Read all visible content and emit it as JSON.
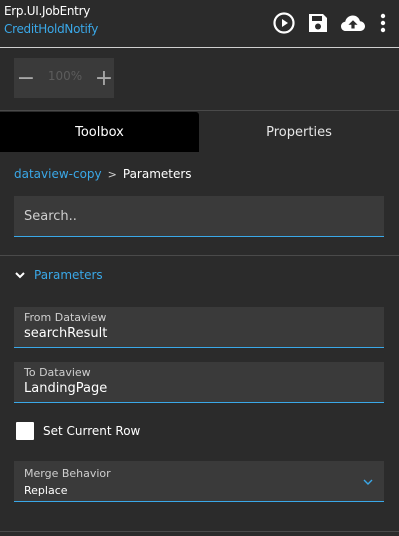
{
  "header": {
    "title": "Erp.UI.JobEntry",
    "subtitle": "CreditHoldNotify",
    "icons": [
      "play-circle-icon",
      "save-icon",
      "cloud-upload-icon",
      "more-vertical-icon"
    ]
  },
  "zoom": {
    "minus": "−",
    "value": "100%",
    "plus": "+"
  },
  "tabs": [
    {
      "label": "Toolbox",
      "active": true
    },
    {
      "label": "Properties",
      "active": false
    }
  ],
  "breadcrumb": {
    "parent": "dataview-copy",
    "separator": ">",
    "current": "Parameters"
  },
  "search": {
    "placeholder": "Search..",
    "value": ""
  },
  "section": {
    "label": "Parameters",
    "expanded": true
  },
  "fields": {
    "from_dataview": {
      "label": "From Dataview",
      "value": "searchResult"
    },
    "to_dataview": {
      "label": "To Dataview",
      "value": "LandingPage"
    },
    "set_current_row": {
      "label": "Set Current Row",
      "checked": false
    },
    "merge_behavior": {
      "label": "Merge Behavior",
      "value": "Replace"
    }
  },
  "colors": {
    "accent": "#3aa8e8",
    "background": "#2b2b2b",
    "field_bg": "#3a3a3a",
    "active_tab": "#000000"
  }
}
